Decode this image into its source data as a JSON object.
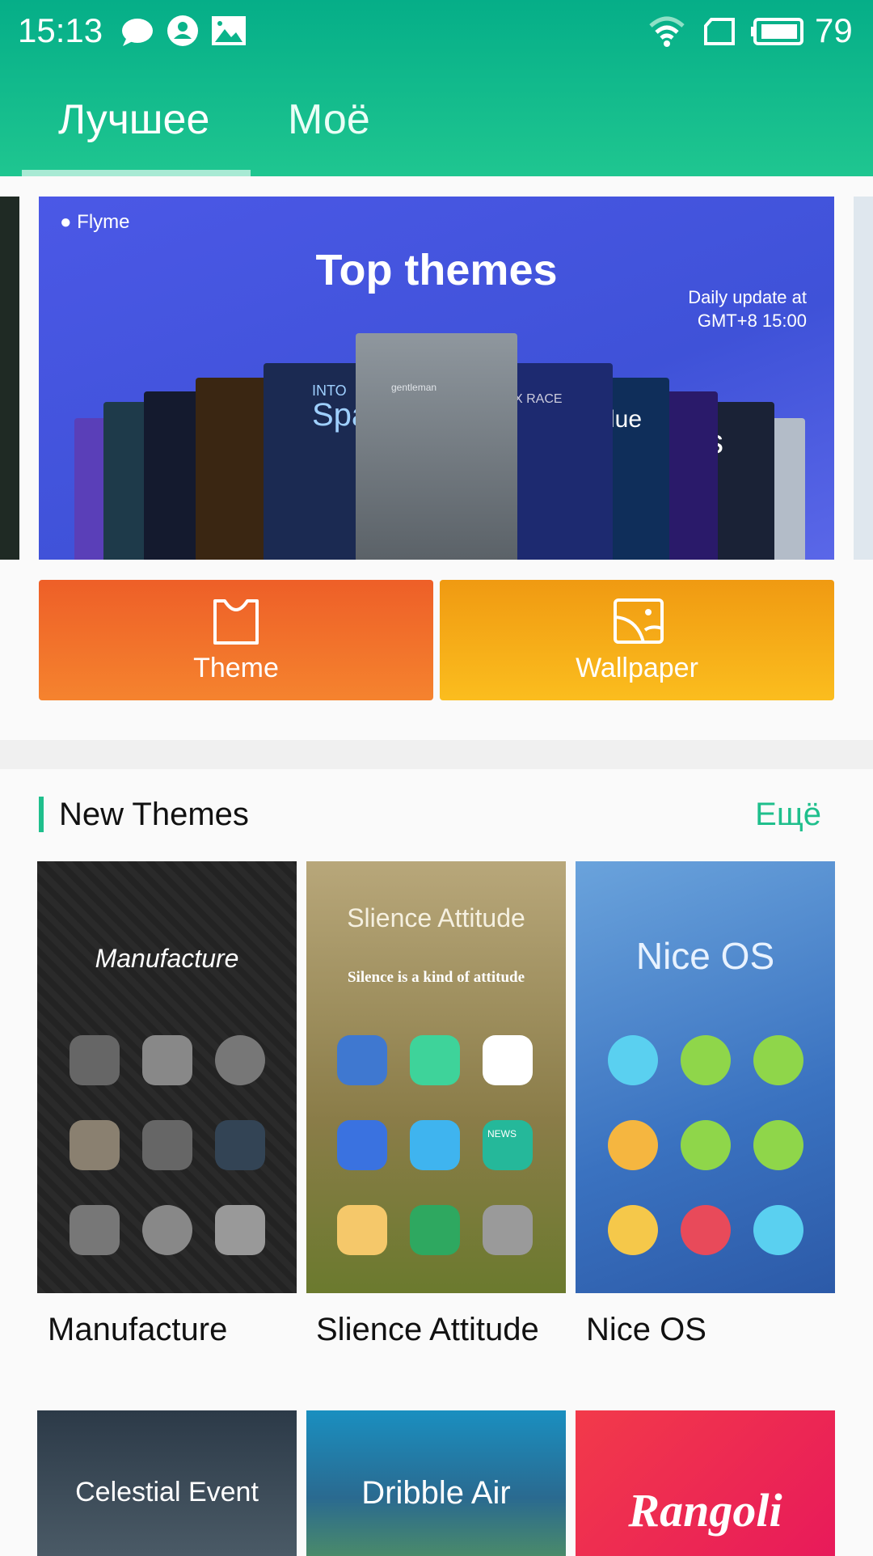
{
  "status_bar": {
    "time": "15:13",
    "battery": "79",
    "icons": [
      "chat-icon",
      "contact-icon",
      "image-icon",
      "wifi-icon",
      "sim-icon",
      "battery-icon"
    ]
  },
  "tabs": [
    {
      "label": "Лучшее",
      "active": true
    },
    {
      "label": "Моё",
      "active": false
    }
  ],
  "banner": {
    "brand": "Flyme",
    "title": "Top themes",
    "subtitle_line1": "Daily update at",
    "subtitle_line2": "GMT+8 15:00",
    "card_texts": [
      "INTO",
      "Spa",
      "Blue",
      "ks",
      "X RACE",
      "gentleman"
    ]
  },
  "buttons": [
    {
      "label": "Theme",
      "icon": "tshirt-icon",
      "color": "#f06a2a"
    },
    {
      "label": "Wallpaper",
      "icon": "wallpaper-icon",
      "color": "#f5a818"
    }
  ],
  "section": {
    "title": "New Themes",
    "more": "Ещё",
    "accent": "#1fbf8c"
  },
  "themes": [
    {
      "name": "Manufacture",
      "cover_title": "Manufacture"
    },
    {
      "name": "Slience Attitude",
      "cover_title": "Slience Attitude",
      "cover_subtitle": "Silence is a kind of attitude",
      "badge": "NEWS"
    },
    {
      "name": "Nice OS",
      "cover_title": "Nice OS"
    }
  ],
  "themes_row2": [
    {
      "cover_title": "Celestial Event"
    },
    {
      "cover_title": "Dribble Air"
    },
    {
      "cover_title": "Rangoli"
    }
  ]
}
